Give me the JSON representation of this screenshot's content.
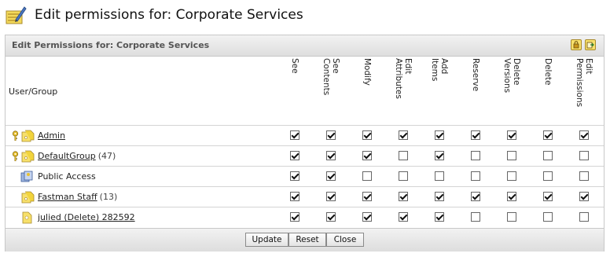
{
  "page": {
    "title": "Edit permissions for: Corporate Services"
  },
  "panel": {
    "header_title": "Edit Permissions for: Corporate Services",
    "header_buttons": [
      "lock-icon",
      "export-icon"
    ]
  },
  "table": {
    "usergroup_header": "User/Group",
    "permission_headers": [
      "See",
      "See\nContents",
      "Modify",
      "Edit\nAttributes",
      "Add\nItems",
      "Reserve",
      "Delete\nVersions",
      "Delete",
      "Edit\nPermissions"
    ],
    "rows": [
      {
        "name": "Admin",
        "count": "",
        "linked": true,
        "key_icon": true,
        "icon": "user-group-icon",
        "perms": [
          true,
          true,
          true,
          true,
          true,
          true,
          true,
          true,
          true
        ]
      },
      {
        "name": "DefaultGroup",
        "count": "(47)",
        "linked": true,
        "key_icon": true,
        "icon": "group-icon",
        "perms": [
          true,
          true,
          true,
          false,
          true,
          false,
          false,
          false,
          false
        ]
      },
      {
        "name": "Public Access",
        "count": "",
        "linked": false,
        "key_icon": false,
        "icon": "public-access-icon",
        "perms": [
          true,
          true,
          false,
          false,
          false,
          false,
          false,
          false,
          false
        ]
      },
      {
        "name": "Fastman Staff",
        "count": "(13)",
        "linked": true,
        "key_icon": false,
        "icon": "group-icon",
        "perms": [
          true,
          true,
          true,
          true,
          true,
          true,
          true,
          true,
          true
        ]
      },
      {
        "name": "julied (Delete) 282592",
        "count": "",
        "linked": true,
        "key_icon": false,
        "icon": "user-icon",
        "perms": [
          true,
          true,
          true,
          true,
          true,
          false,
          false,
          false,
          false
        ]
      }
    ]
  },
  "footer": {
    "update_label": "Update",
    "reset_label": "Reset",
    "close_label": "Close"
  },
  "colors": {
    "panel_header_bg": "#e4e4e4",
    "folder_yellow": "#f2d43c",
    "key_yellow": "#e8c030"
  }
}
